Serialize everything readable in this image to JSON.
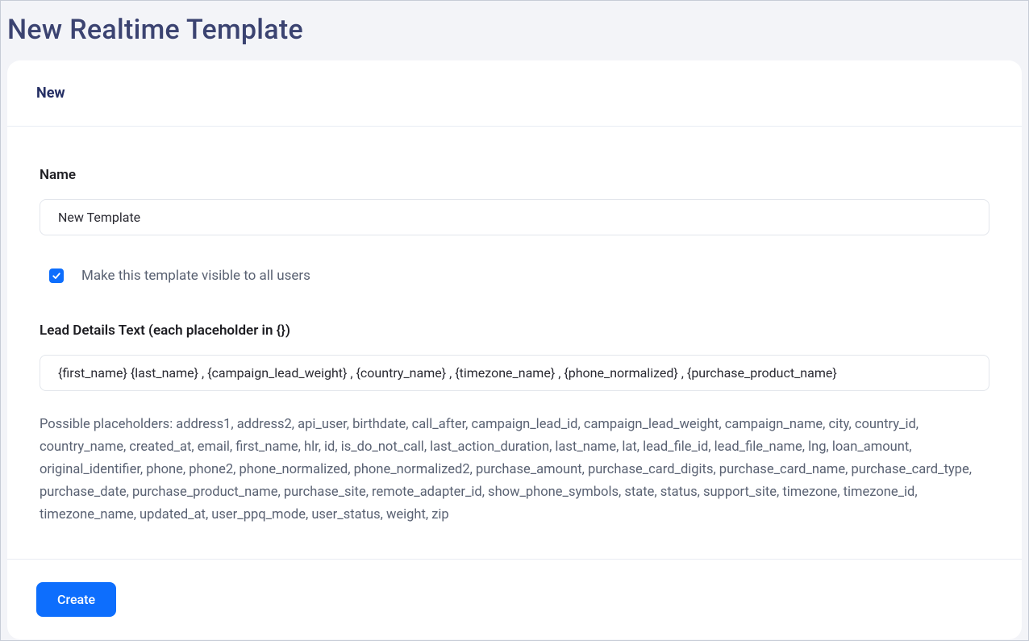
{
  "page": {
    "title": "New Realtime Template"
  },
  "card": {
    "header_title": "New"
  },
  "form": {
    "name_label": "Name",
    "name_value": "New Template",
    "visibility_checked": true,
    "visibility_label": "Make this template visible to all users",
    "lead_details_label": "Lead Details Text (each placeholder in {})",
    "lead_details_value": "{first_name} {last_name} , {campaign_lead_weight} , {country_name} , {timezone_name} , {phone_normalized} , {purchase_product_name}",
    "placeholder_help_prefix": "Possible placeholders: ",
    "placeholder_list": "address1, address2, api_user, birthdate, call_after, campaign_lead_id, campaign_lead_weight, campaign_name, city, country_id, country_name, created_at, email, first_name, hlr, id, is_do_not_call, last_action_duration, last_name, lat, lead_file_id, lead_file_name, lng, loan_amount, original_identifier, phone, phone2, phone_normalized, phone_normalized2, purchase_amount, purchase_card_digits, purchase_card_name, purchase_card_type, purchase_date, purchase_product_name, purchase_site, remote_adapter_id, show_phone_symbols, state, status, support_site, timezone, timezone_id, timezone_name, updated_at, user_ppq_mode, user_status, weight, zip"
  },
  "footer": {
    "create_label": "Create"
  }
}
